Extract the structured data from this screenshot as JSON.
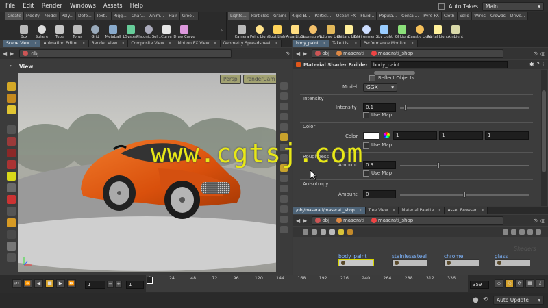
{
  "menu": [
    "File",
    "Edit",
    "Render",
    "Windows",
    "Assets",
    "Help"
  ],
  "menubar_right": {
    "auto_takes_label": "Auto Takes",
    "desktop": "Main"
  },
  "shelf_left": {
    "tabs": [
      "Create",
      "Modify",
      "Model",
      "Poly...",
      "Defo...",
      "Text...",
      "Rigg...",
      "Char...",
      "Anim...",
      "Hair",
      "Groo..."
    ],
    "tools": [
      "Box",
      "Sphere",
      "Tube",
      "Torus",
      "Grid",
      "Metaball",
      "LSystem",
      "Platonic Sol...",
      "Curve",
      "Draw Curve"
    ]
  },
  "shelf_right": {
    "tabs": [
      "Lights...",
      "Particles",
      "Grains",
      "Rigid B...",
      "Particl...",
      "Ocean FX",
      "Fluid...",
      "Popula...",
      "Contai...",
      "Pyro FX",
      "Cloth",
      "Solid",
      "Wires",
      "Crowds",
      "Drive..."
    ],
    "tools": [
      "Camera",
      "Point Light",
      "Spot Light",
      "Area Light",
      "Geometry L...",
      "Volume Light",
      "Distant Light",
      "Environmen...",
      "Sky Light",
      "GI Light",
      "Caustic Light",
      "Portal Light",
      "Ambient"
    ]
  },
  "left_pane": {
    "tabs": [
      "Scene View",
      "Animation Editor",
      "Render View",
      "Composite View",
      "Motion FX View",
      "Geometry Spreadsheet"
    ],
    "path": "obj",
    "view_label": "View",
    "camera_menus": [
      "Persp",
      "renderCam"
    ]
  },
  "param_pane": {
    "tabs": [
      "body_paint",
      "Take List",
      "Performance Monitor"
    ],
    "path": [
      "obj",
      "maserati",
      "maserati_shop"
    ],
    "node_type": "Material Shader Builder",
    "node_name": "body_paint",
    "reflect_objects_label": "Reflect Objects",
    "model_label": "Model",
    "model_value": "GGX",
    "sections": [
      {
        "title": "Intensity",
        "param": "Intensity",
        "value": "0.1",
        "use_map": "Use Map",
        "slider": 0.04
      },
      {
        "title": "Color",
        "param": "Color",
        "values": [
          "1",
          "1",
          "1"
        ],
        "use_map": "Use Map"
      },
      {
        "title": "Roughness",
        "param": "Amount",
        "value": "0.3",
        "use_map": "Use Map",
        "slider": 0.3
      },
      {
        "title": "Anisotropy",
        "param": "Amount",
        "value": "0",
        "slider": 0.5
      }
    ]
  },
  "network_pane": {
    "tabs": [
      "/obj/maserati/maserati_shop",
      "Tree View",
      "Material Palette",
      "Asset Browser"
    ],
    "path": [
      "obj",
      "maserati",
      "maserati_shop"
    ],
    "corner_label": "Shaders",
    "materials": [
      "body_paint",
      "stainlesssteel",
      "chrome",
      "glass"
    ]
  },
  "timeline": {
    "frame": "1",
    "start": "1",
    "end": "359",
    "ticks": [
      "1",
      "24",
      "48",
      "72",
      "96",
      "120",
      "144",
      "168",
      "192",
      "216",
      "240",
      "264",
      "288",
      "312",
      "336"
    ]
  },
  "status": {
    "update_mode": "Auto Update"
  },
  "watermark": "www.cgtsj.com",
  "colors": {
    "accent": "#4e6478",
    "car": "#e0560e",
    "selection": "#d6d600",
    "link": "#7fb6ff"
  }
}
